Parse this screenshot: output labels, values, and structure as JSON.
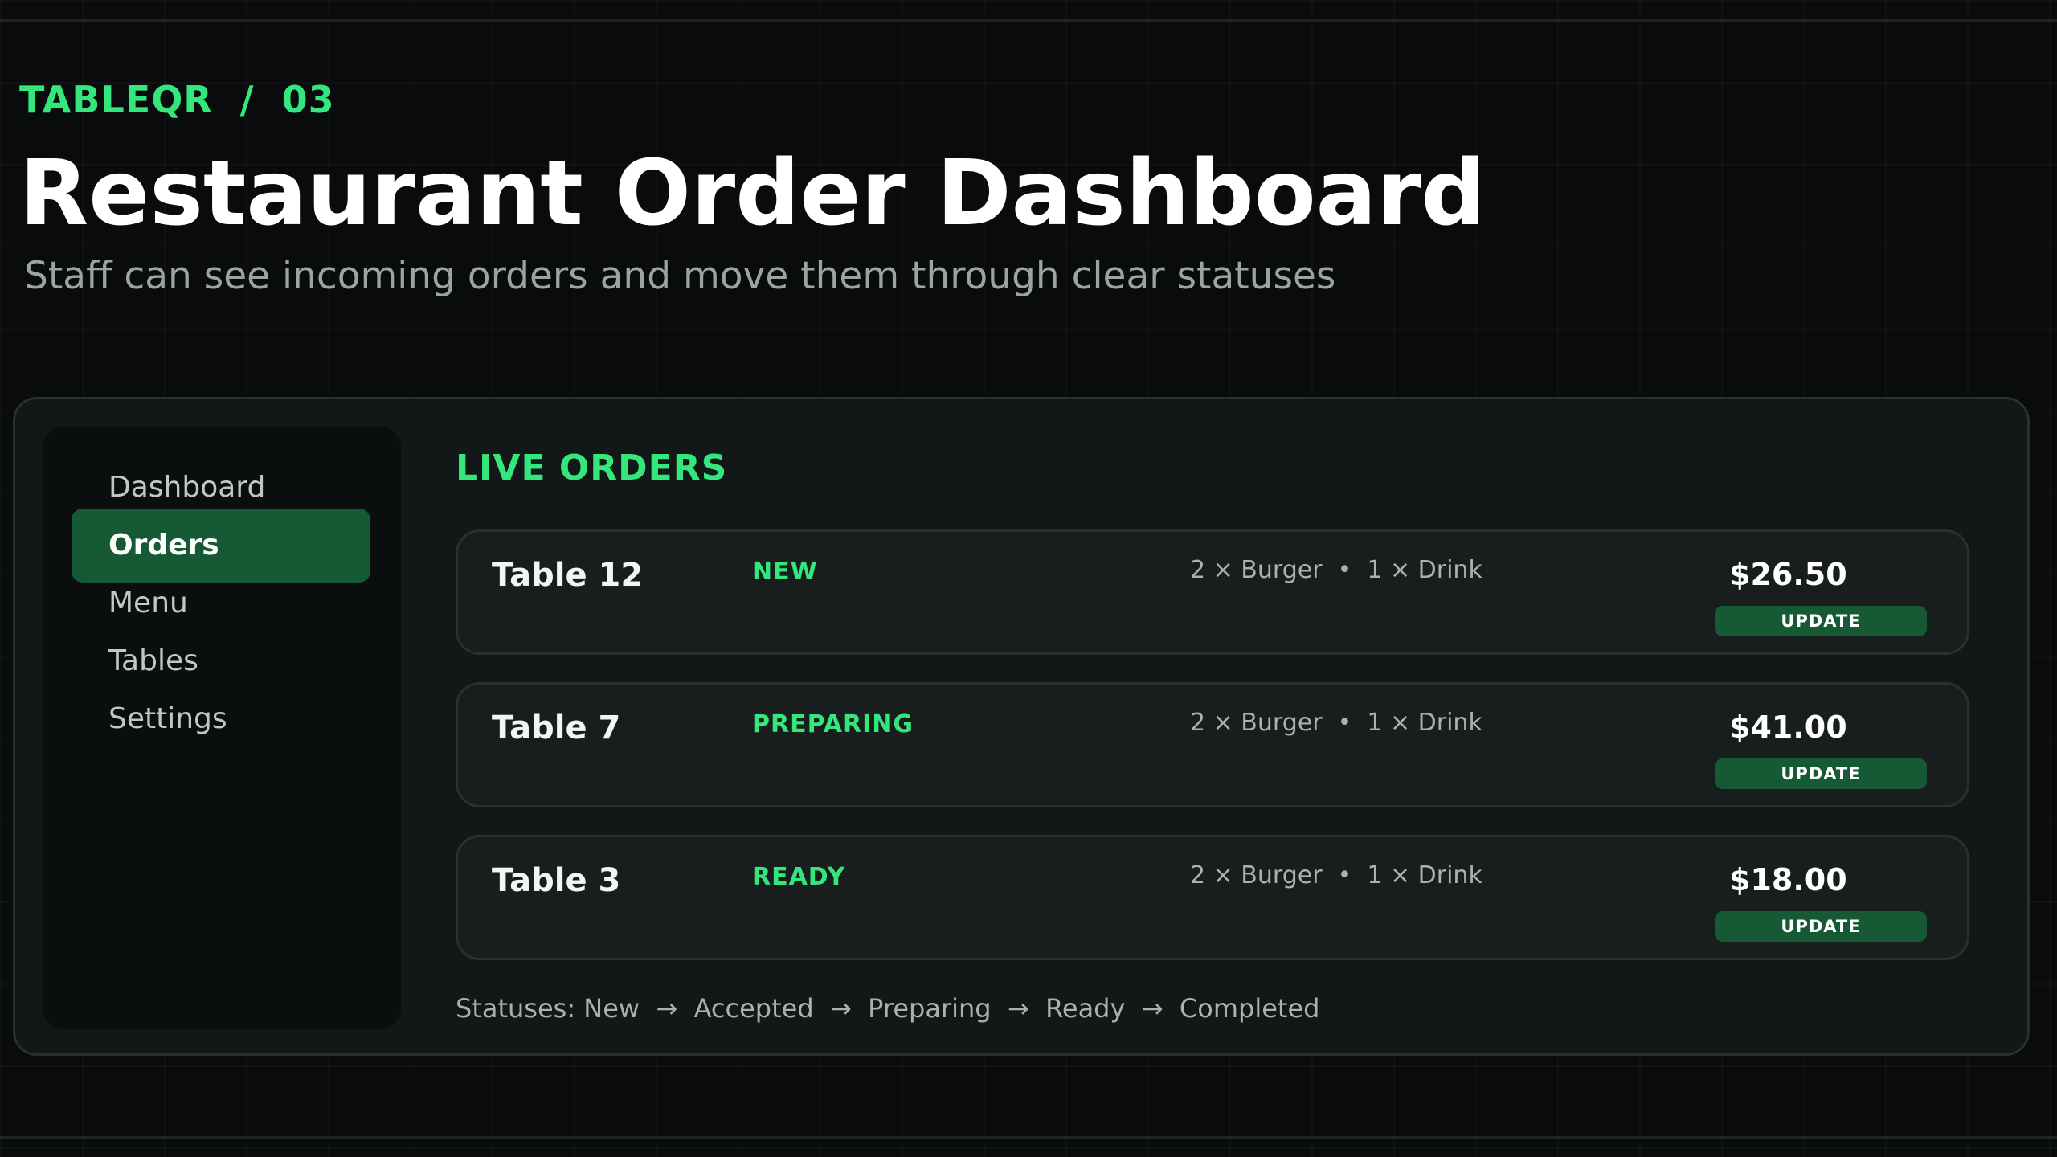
{
  "header": {
    "brand": "TABLEQR  /  03",
    "title": "Restaurant Order Dashboard",
    "subtitle": "Staff can see incoming orders and move them through clear statuses"
  },
  "sidebar": {
    "items": [
      {
        "label": "Dashboard",
        "active": false
      },
      {
        "label": "Orders",
        "active": true
      },
      {
        "label": "Menu",
        "active": false
      },
      {
        "label": "Tables",
        "active": false
      },
      {
        "label": "Settings",
        "active": false
      }
    ]
  },
  "main": {
    "section_title": "LIVE ORDERS",
    "orders": [
      {
        "table": "Table 12",
        "status": "NEW",
        "items": "2 × Burger  •  1 × Drink",
        "total": "$26.50",
        "action": "UPDATE"
      },
      {
        "table": "Table 7",
        "status": "PREPARING",
        "items": "2 × Burger  •  1 × Drink",
        "total": "$41.00",
        "action": "UPDATE"
      },
      {
        "table": "Table 3",
        "status": "READY",
        "items": "2 × Burger  •  1 × Drink",
        "total": "$18.00",
        "action": "UPDATE"
      }
    ],
    "status_flow": "Statuses: New  →  Accepted  →  Preparing  →  Ready  →  Completed"
  },
  "colors": {
    "background": "#090b0d",
    "panel": "#121717",
    "sidebar": "#0b0e0e",
    "accent": "#34e77c",
    "button": "#155a34",
    "border": "#253230",
    "muted_text": "#9ba4a0"
  }
}
